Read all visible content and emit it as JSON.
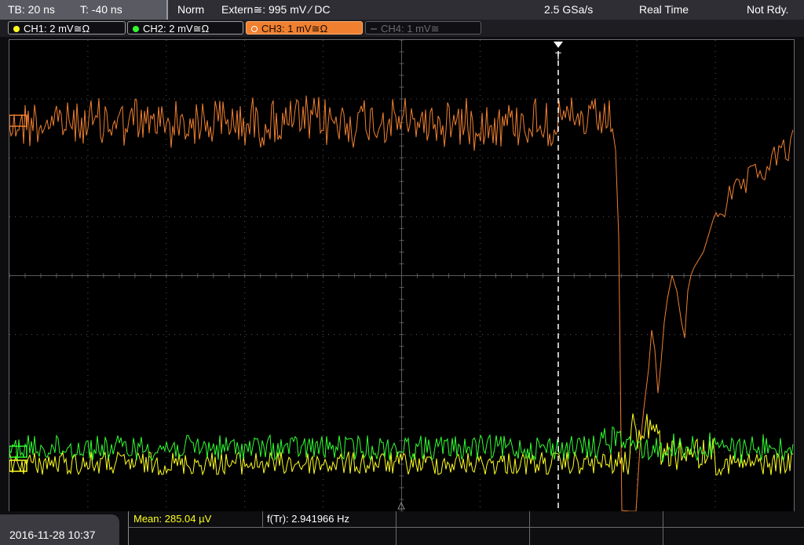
{
  "status_bar": {
    "timebase": "TB: 20 ns",
    "trigger_time": "T: -40 ns",
    "trigger_mode": "Norm",
    "trigger_source": "Extern≅: 995 mV ⁄ DC",
    "sample_rate": "2.5 GSa/s",
    "acq_mode": "Real Time",
    "state": "Not Rdy."
  },
  "channels": [
    {
      "label": "CH1: 2 mV≅Ω",
      "color": "#ffff20",
      "active": false,
      "enabled": true
    },
    {
      "label": "CH2: 2 mV≅Ω",
      "color": "#30ff30",
      "active": false,
      "enabled": true
    },
    {
      "label": "CH3: 1 mV≅Ω",
      "color": "#f08030",
      "active": true,
      "enabled": true
    },
    {
      "label": "CH4: 1 mV≅",
      "color": "#6a6a70",
      "active": false,
      "enabled": false
    }
  ],
  "trigger_marker": "T",
  "measurements": {
    "mean": "Mean: 285.04 µV",
    "freq": "f(Tr): 2.941966 Hz"
  },
  "datetime": "2016-11-28 10:37",
  "colors": {
    "ch1": "#ffff20",
    "ch2": "#30ff30",
    "ch3": "#f08030",
    "grid": "#5a5a5a"
  }
}
